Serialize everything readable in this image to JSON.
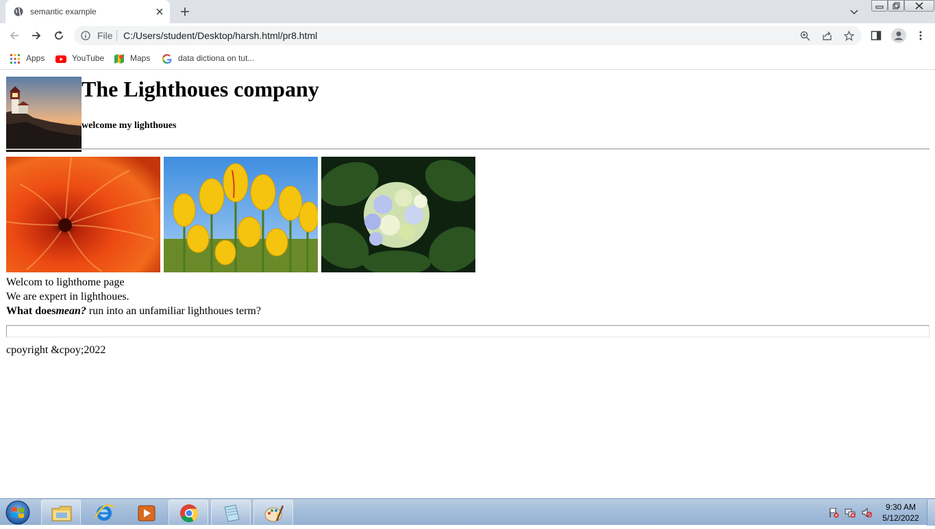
{
  "browser": {
    "tab": {
      "title": "semantic example"
    },
    "address_bar": {
      "scheme_label": "File",
      "url": "C:/Users/student/Desktop/harsh.html/pr8.html"
    },
    "bookmarks": [
      {
        "label": "Apps",
        "icon": "apps-grid-icon"
      },
      {
        "label": "YouTube",
        "icon": "youtube-icon"
      },
      {
        "label": "Maps",
        "icon": "maps-icon"
      },
      {
        "label": "data dictiona on tut...",
        "icon": "google-icon"
      }
    ]
  },
  "page": {
    "logo_icon": "lighthouse-photo",
    "heading": "The Lighthoues company",
    "subheading": "welcome my lighthoues",
    "gallery": [
      {
        "icon": "orange-chrysanthemum-photo"
      },
      {
        "icon": "yellow-tulips-photo"
      },
      {
        "icon": "hydrangea-photo"
      }
    ],
    "welcome_text": "Welcom to lighthome page",
    "expert_text": "We are expert in lighthoues.",
    "question": {
      "bold": "What does",
      "emphasis": "mean?",
      "rest": " run into an unfamiliar lighthoues term?"
    },
    "copyright": "cpoyright &cpoy;2022"
  },
  "taskbar": {
    "pinned": [
      {
        "icon": "file-explorer-icon",
        "active": true
      },
      {
        "icon": "internet-explorer-icon",
        "active": false
      },
      {
        "icon": "media-player-icon",
        "active": false
      },
      {
        "icon": "chrome-icon",
        "active": true
      },
      {
        "icon": "notepad-icon",
        "active": true
      },
      {
        "icon": "paint-icon",
        "active": true
      }
    ],
    "tray_icons": [
      "action-center-flag-icon",
      "network-icon",
      "volume-muted-icon"
    ],
    "clock": {
      "time": "9:30 AM",
      "date": "5/12/2022"
    }
  },
  "colors": {
    "tab_strip": "#dee1e6",
    "omnibox": "#f1f3f4",
    "taskbar": "#a6bfdb"
  }
}
